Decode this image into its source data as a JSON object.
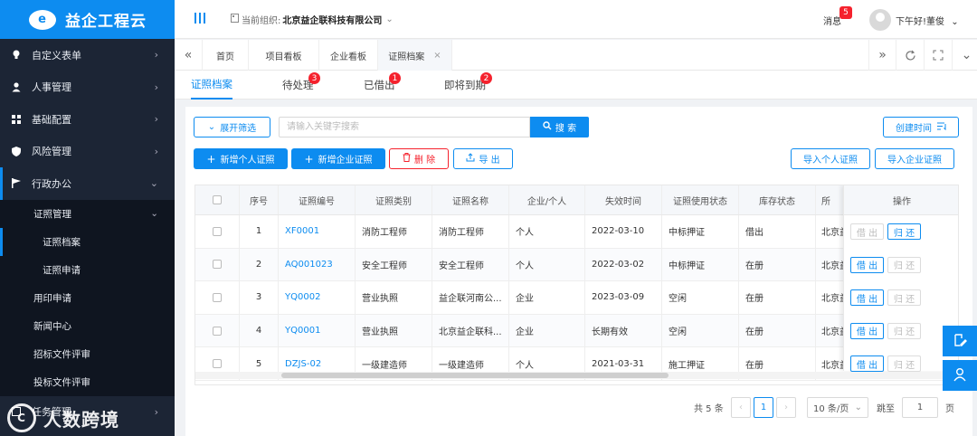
{
  "brand": {
    "name": "益企工程云",
    "logo_mark": "e"
  },
  "sidebar": {
    "items": [
      {
        "label": "自定义表单",
        "icon": "bulb-icon"
      },
      {
        "label": "人事管理",
        "icon": "person-icon"
      },
      {
        "label": "基础配置",
        "icon": "grid-icon"
      },
      {
        "label": "风险管理",
        "icon": "shield-icon"
      },
      {
        "label": "行政办公",
        "icon": "flag-icon"
      }
    ],
    "submenu": {
      "label": "证照管理"
    },
    "sub_items": [
      "证照档案",
      "证照申请"
    ],
    "second_items": [
      "用印申请",
      "新闻中心",
      "招标文件评审",
      "投标文件评审",
      "任务管理"
    ]
  },
  "watermark": {
    "mark": "C",
    "text": "人数跨境"
  },
  "header": {
    "org_label": "当前组织:",
    "org_name": "北京益企联科技有限公司",
    "messages_label": "消息",
    "messages_count": "5",
    "greeting": "下午好!",
    "user_name": "董俊"
  },
  "tabs": [
    "首页",
    "项目看板",
    "企业看板",
    "证照档案"
  ],
  "subtabs": [
    {
      "label": "证照档案",
      "badge": ""
    },
    {
      "label": "待处理",
      "badge": "3"
    },
    {
      "label": "已借出",
      "badge": "1"
    },
    {
      "label": "即将到期",
      "badge": "2"
    }
  ],
  "filter": {
    "expand_label": "展开筛选",
    "search_placeholder": "请输入关键字搜索",
    "search_button": "搜 索",
    "sort_label": "创建时间"
  },
  "actions": {
    "add_personal": "新增个人证照",
    "add_company": "新增企业证照",
    "delete": "删 除",
    "export": "导 出",
    "import_personal": "导入个人证照",
    "import_company": "导入企业证照"
  },
  "table": {
    "headers": [
      "序号",
      "证照编号",
      "证照类别",
      "证照名称",
      "企业/个人",
      "失效时间",
      "证照使用状态",
      "库存状态",
      "所",
      "操作"
    ],
    "rows": [
      {
        "no": "1",
        "code": "XF0001",
        "category": "消防工程师",
        "name": "消防工程师",
        "type": "个人",
        "expire": "2022-03-10",
        "use_status": "中标押证",
        "stock": "借出",
        "location": "北京益",
        "borrow_enabled": false,
        "return_enabled": true
      },
      {
        "no": "2",
        "code": "AQ001023",
        "category": "安全工程师",
        "name": "安全工程师",
        "type": "个人",
        "expire": "2022-03-02",
        "use_status": "中标押证",
        "stock": "在册",
        "location": "北京益",
        "borrow_enabled": true,
        "return_enabled": false
      },
      {
        "no": "3",
        "code": "YQ0002",
        "category": "营业执照",
        "name": "益企联河南公...",
        "type": "企业",
        "expire": "2023-03-09",
        "use_status": "空闲",
        "stock": "在册",
        "location": "北京益",
        "borrow_enabled": true,
        "return_enabled": false
      },
      {
        "no": "4",
        "code": "YQ0001",
        "category": "营业执照",
        "name": "北京益企联科...",
        "type": "企业",
        "expire": "长期有效",
        "use_status": "空闲",
        "stock": "在册",
        "location": "北京益",
        "borrow_enabled": true,
        "return_enabled": false
      },
      {
        "no": "5",
        "code": "DZJS-02",
        "category": "一级建造师",
        "name": "一级建造师",
        "type": "个人",
        "expire": "2021-03-31",
        "use_status": "施工押证",
        "stock": "在册",
        "location": "北京益",
        "borrow_enabled": true,
        "return_enabled": false
      }
    ],
    "borrow_label": "借 出",
    "return_label": "归 还"
  },
  "pagination": {
    "total": "共 5 条",
    "current_page": "1",
    "page_size": "10 条/页",
    "goto_label": "跳至",
    "goto_value": "1",
    "page_unit": "页"
  },
  "colors": {
    "primary": "#0d8cf0",
    "danger": "#f5222d",
    "sidebar_bg": "#1c2535"
  }
}
